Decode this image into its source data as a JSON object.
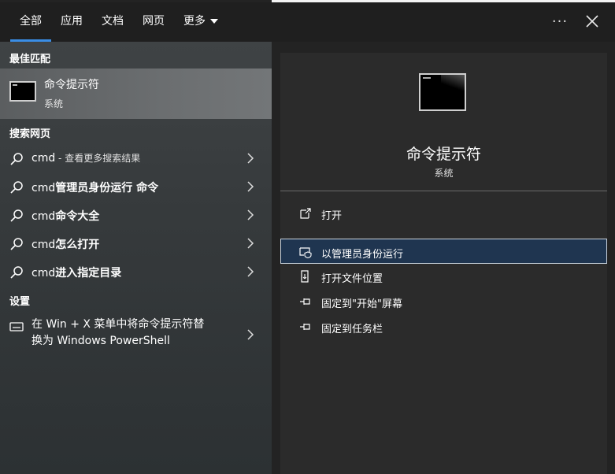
{
  "tabs": [
    {
      "label": "全部",
      "active": true
    },
    {
      "label": "应用",
      "active": false
    },
    {
      "label": "文档",
      "active": false
    },
    {
      "label": "网页",
      "active": false
    },
    {
      "label": "更多",
      "active": false
    }
  ],
  "header": {
    "more_icon": "ellipsis-icon",
    "close_icon": "close-icon"
  },
  "left": {
    "best_match_heading": "最佳匹配",
    "best_match": {
      "title": "命令提示符",
      "subtitle": "系统",
      "icon": "terminal-icon"
    },
    "web_heading": "搜索网页",
    "web_results": [
      {
        "query": "cmd",
        "suffix": " - 查看更多搜索结果"
      },
      {
        "query": "cmd",
        "suffix": "管理员身份运行 命令"
      },
      {
        "query": "cmd",
        "suffix": "命令大全"
      },
      {
        "query": "cmd",
        "suffix": "怎么打开"
      },
      {
        "query": "cmd",
        "suffix": "进入指定目录"
      }
    ],
    "settings_heading": "设置",
    "settings_item": {
      "line1": "在 Win + X 菜单中将命令提示符替",
      "line2": "换为 Windows PowerShell"
    }
  },
  "preview": {
    "title": "命令提示符",
    "subtitle": "系统",
    "actions": [
      {
        "label": "打开",
        "icon": "open-icon",
        "selected": false
      },
      {
        "label": "以管理员身份运行",
        "icon": "shield-icon",
        "selected": true
      },
      {
        "label": "打开文件位置",
        "icon": "file-location-icon",
        "selected": false
      },
      {
        "label": "固定到\"开始\"屏幕",
        "icon": "pin-icon",
        "selected": false
      },
      {
        "label": "固定到任务栏",
        "icon": "pin-icon",
        "selected": false
      }
    ]
  },
  "colors": {
    "accent": "#3a8ee6",
    "selected_bg": "#1f3550"
  }
}
